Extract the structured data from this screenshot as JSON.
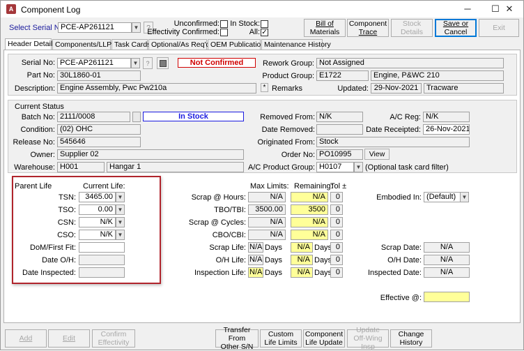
{
  "window": {
    "title": "Component Log",
    "app_icon": "A"
  },
  "top": {
    "select_label": "Select Serial No:",
    "serial": "PCE-AP261121",
    "help": "?",
    "unconfirmed": "Unconfirmed:",
    "effectivity_confirmed": "Effectivity Confirmed:",
    "in_stock": "In Stock:",
    "all": "All:",
    "check": "✓",
    "bill_1": "Bill of",
    "bill_2": "Materials",
    "trace_1": "Component",
    "trace_2": "Trace",
    "stock_1": "Stock",
    "stock_2": "Details",
    "save_1": "Save or",
    "save_2": "Cancel",
    "exit": "Exit"
  },
  "tabs": [
    "Header Details",
    "Components/LLP's",
    "Task Cards",
    "Optional/As Req'd",
    "OEM Publications",
    "Maintenance History"
  ],
  "header": {
    "serial_label": "Serial No:",
    "serial": "PCE-AP261121",
    "not_confirmed": "Not Confirmed",
    "part_label": "Part No:",
    "part": "30L1860-01",
    "desc_label": "Description:",
    "desc": "Engine Assembly, Pwc Pw210a",
    "rework_label": "Rework Group:",
    "rework": "Not Assigned",
    "product_label": "Product Group:",
    "product_code": "E1722",
    "product_name": "Engine, P&WC 210",
    "remarks_star": "*",
    "remarks_label": "Remarks",
    "updated_label": "Updated:",
    "updated_date": "29-Nov-2021",
    "updated_by": "Tracware"
  },
  "status": {
    "title": "Current Status",
    "batch_label": "Batch No:",
    "batch": "2111/0008",
    "in_stock": "In Stock",
    "condition_label": "Condition:",
    "condition": "(02) OHC",
    "release_label": "Release No:",
    "release": "545646",
    "owner_label": "Owner:",
    "owner": "Supplier 02",
    "warehouse_label": "Warehouse:",
    "warehouse_code": "H001",
    "warehouse_name": "Hangar 1",
    "removed_from_label": "Removed From:",
    "removed_from": "N/K",
    "acreg_label": "A/C Reg:",
    "acreg": "N/K",
    "date_removed_label": "Date Removed:",
    "date_received_label": "Date Receipted:",
    "date_received": "26-Nov-2021",
    "originated_label": "Originated From:",
    "originated": "Stock",
    "order_label": "Order No:",
    "order": "PO10995",
    "view": "View",
    "acpg_label": "A/C Product Group:",
    "acpg": "H0107",
    "acpg_note": "(Optional task card filter)"
  },
  "life": {
    "parent_life": "Parent Life",
    "current_life": "Current Life:",
    "tsn_label": "TSN:",
    "tsn": "3465.00",
    "tso_label": "TSO:",
    "tso": "0.00",
    "csn_label": "CSN:",
    "csn": "N/K",
    "cso_label": "CSO:",
    "cso": "N/K",
    "dom_label": "DoM/First Fit:",
    "dateoh_label": "Date O/H:",
    "inspected_label": "Date Inspected:",
    "max_limits": "Max Limits:",
    "remaining": "Remaining:",
    "tol": "Tol ±",
    "scrap_hours_label": "Scrap @ Hours:",
    "scrap_hours": "N/A",
    "scrap_hours_rem": "N/A",
    "scrap_hours_tol": "0",
    "tbo_label": "TBO/TBI:",
    "tbo": "3500.00",
    "tbo_rem": "3500",
    "tbo_tol": "0",
    "scrap_cycles_label": "Scrap @ Cycles:",
    "scrap_cycles": "N/A",
    "scrap_cycles_rem": "N/A",
    "scrap_cycles_tol": "0",
    "cbo_label": "CBO/CBI:",
    "cbo": "N/A",
    "cbo_rem": "N/A",
    "cbo_tol": "0",
    "scrap_life_label": "Scrap Life:",
    "scrap_life": "N/A",
    "oh_life_label": "O/H Life:",
    "oh_life": "N/A",
    "insp_life_label": "Inspection Life:",
    "insp_life": "N/A",
    "days": "Days",
    "rem_na": "N/A",
    "tol0": "0",
    "embodied_label": "Embodied In:",
    "embodied": "(Default)",
    "scrap_date_label": "Scrap Date:",
    "scrap_date": "N/A",
    "oh_date_label": "O/H Date:",
    "oh_date": "N/A",
    "insp_date_label": "Inspected Date:",
    "insp_date": "N/A",
    "effective_label": "Effective @:"
  },
  "bottom": {
    "add": "Add",
    "edit": "Edit",
    "confirm_1": "Confirm",
    "confirm_2": "Effectivity",
    "transfer_1": "Transfer From",
    "transfer_2": "Other S/N",
    "custom_1": "Custom",
    "custom_2": "Life Limits",
    "clu_1": "Component",
    "clu_2": "Life Update",
    "update_1": "Update",
    "update_2": "Off-Wing Insp",
    "change_1": "Change",
    "change_2": "History"
  }
}
